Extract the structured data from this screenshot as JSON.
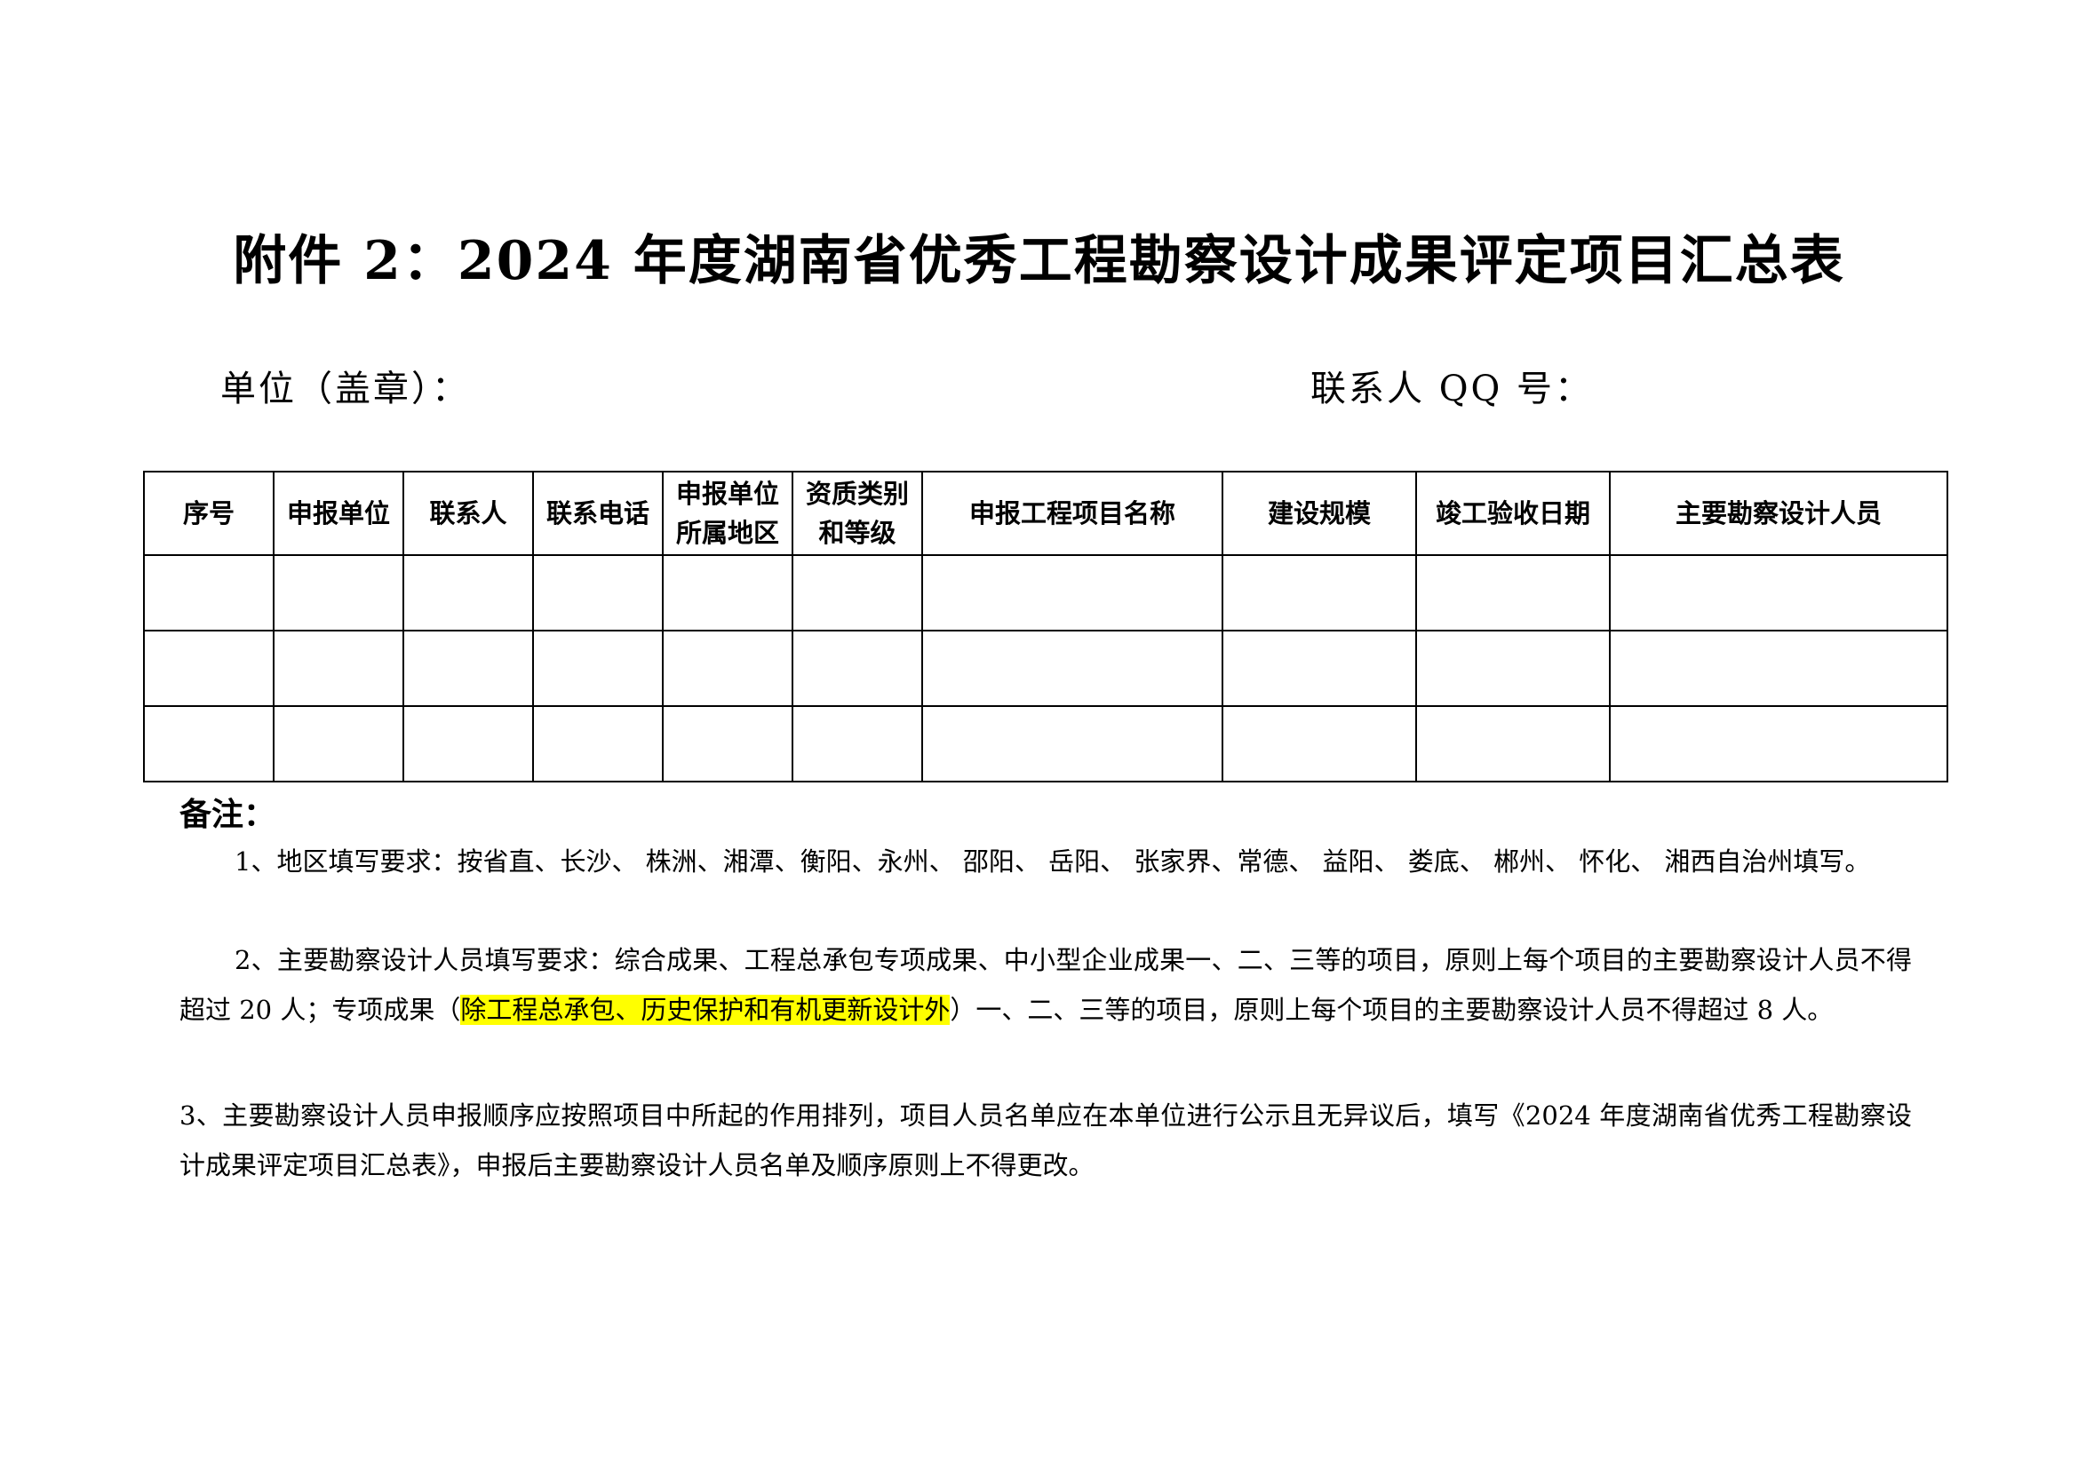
{
  "document": {
    "title": "附件 2：2024 年度湖南省优秀工程勘察设计成果评定项目汇总表",
    "unit_label": "单位（盖章）：",
    "qq_label": "联系人 QQ 号："
  },
  "table": {
    "headers": [
      "序号",
      "申报单位",
      "联系人",
      "联系电话",
      "申报单位所属地区",
      "资质类别和等级",
      "申报工程项目名称",
      "建设规模",
      "竣工验收日期",
      "主要勘察设计人员"
    ],
    "row_count": 3
  },
  "notes": {
    "title": "备注：",
    "note1": "1、地区填写要求：按省直、长沙、 株洲、湘潭、衡阳、永州、 邵阳、 岳阳、 张家界、常德、 益阳、 娄底、 郴州、 怀化、 湘西自治州填写。",
    "note2_before": "2、主要勘察设计人员填写要求：综合成果、工程总承包专项成果、中小型企业成果一、二、三等的项目，原则上每个项目的主要勘察设计人员不得超过 20 人；专项成果（",
    "note2_highlight": "除工程总承包、历史保护和有机更新设计外",
    "note2_after": "）一、二、三等的项目，原则上每个项目的主要勘察设计人员不得超过 8 人。",
    "note3": "3、主要勘察设计人员申报顺序应按照项目中所起的作用排列，项目人员名单应在本单位进行公示且无异议后，填写《2024 年度湖南省优秀工程勘察设计成果评定项目汇总表》，申报后主要勘察设计人员名单及顺序原则上不得更改。"
  },
  "colors": {
    "highlight": "#ffff00",
    "text": "#000000",
    "border": "#000000"
  }
}
